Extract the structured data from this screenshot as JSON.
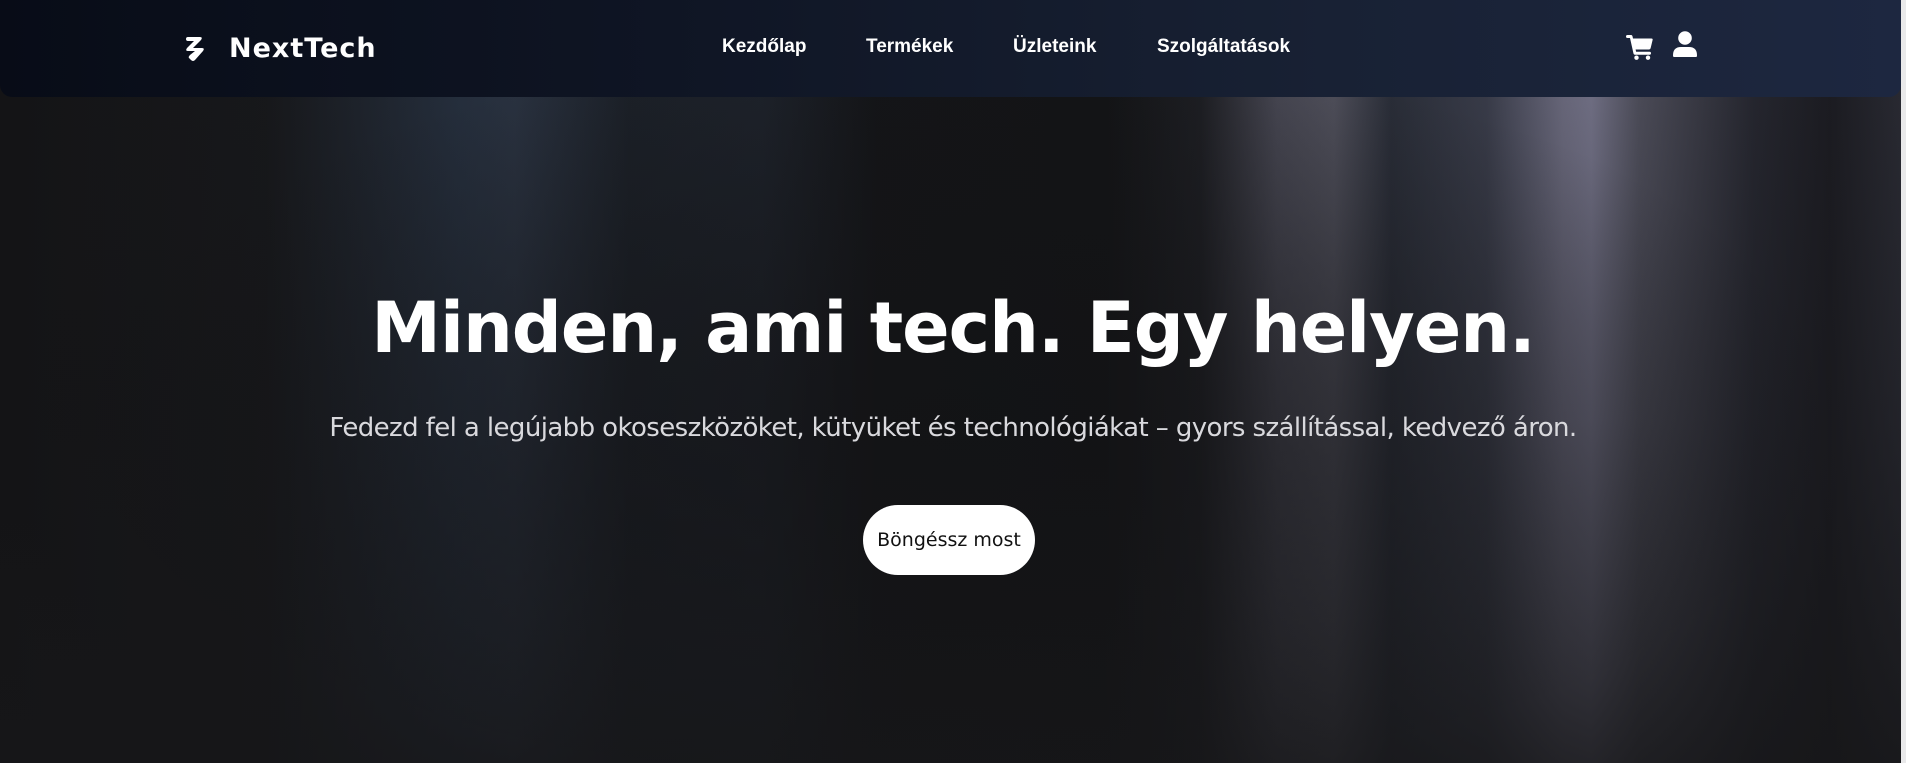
{
  "brand": {
    "name": "NextTech",
    "logo_icon": "z-bolt-logo-icon"
  },
  "nav": {
    "items": [
      {
        "label": "Kezdőlap"
      },
      {
        "label": "Termékek"
      },
      {
        "label": "Üzleteink"
      },
      {
        "label": "Szolgáltatások"
      }
    ],
    "icons": {
      "cart": "shopping-cart-icon",
      "user": "user-account-icon"
    }
  },
  "hero": {
    "title": "Minden, ami tech. Egy helyen.",
    "subtitle": "Fedezd fel a legújabb okoseszközöket, kütyüket és technológiákat – gyors szállítással, kedvező áron.",
    "cta_label": "Böngéssz most"
  },
  "colors": {
    "header_bg_start": "#080c17",
    "header_bg_end": "#1d2740",
    "text": "#ffffff",
    "cta_bg": "#ffffff",
    "cta_text": "#111111"
  }
}
